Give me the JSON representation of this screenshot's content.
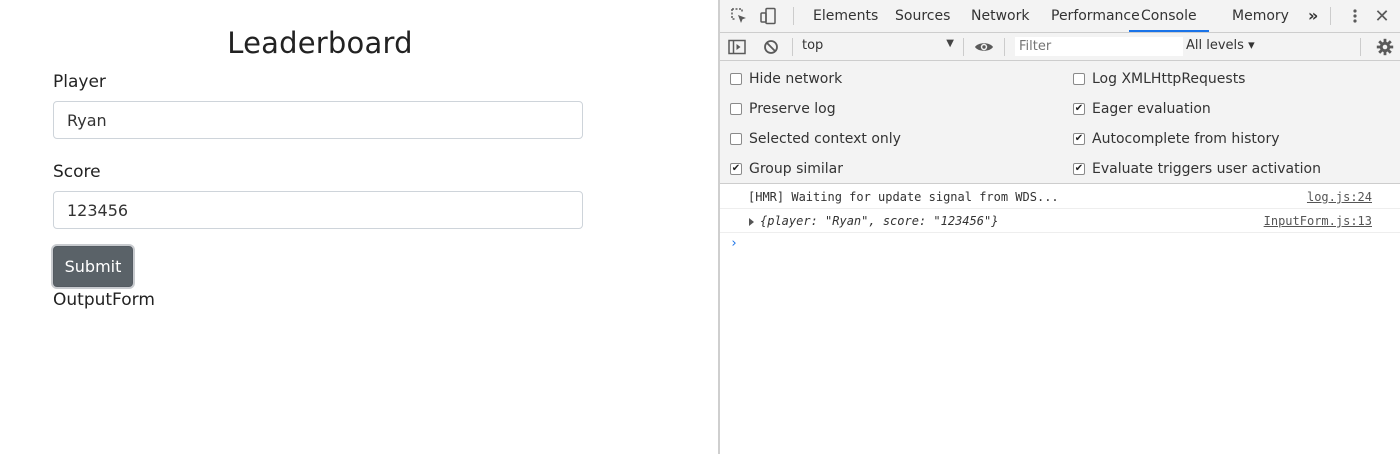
{
  "app": {
    "title": "Leaderboard",
    "player_label": "Player",
    "player_value": "Ryan",
    "score_label": "Score",
    "score_value": "123456",
    "submit_label": "Submit",
    "output_label": "OutputForm"
  },
  "devtools": {
    "tabs": [
      "Elements",
      "Sources",
      "Network",
      "Performance",
      "Console",
      "Memory"
    ],
    "active_tab": "Console",
    "more_label": "»",
    "context": "top",
    "filter_placeholder": "Filter",
    "levels": "All levels ▾",
    "settings": {
      "left": [
        {
          "label": "Hide network",
          "checked": false
        },
        {
          "label": "Preserve log",
          "checked": false
        },
        {
          "label": "Selected context only",
          "checked": false
        },
        {
          "label": "Group similar",
          "checked": true
        }
      ],
      "right": [
        {
          "label": "Log XMLHttpRequests",
          "checked": false
        },
        {
          "label": "Eager evaluation",
          "checked": true
        },
        {
          "label": "Autocomplete from history",
          "checked": true
        },
        {
          "label": "Evaluate triggers user activation",
          "checked": true
        }
      ]
    },
    "messages": [
      {
        "text": "[HMR] Waiting for update signal from WDS...",
        "source": "log.js:24"
      },
      {
        "text": "{player: \"Ryan\", score: \"123456\"}",
        "source": "InputForm.js:13"
      }
    ],
    "prompt": "›"
  },
  "colors": {
    "accent": "#1a73e8",
    "button": "#5a6268"
  }
}
